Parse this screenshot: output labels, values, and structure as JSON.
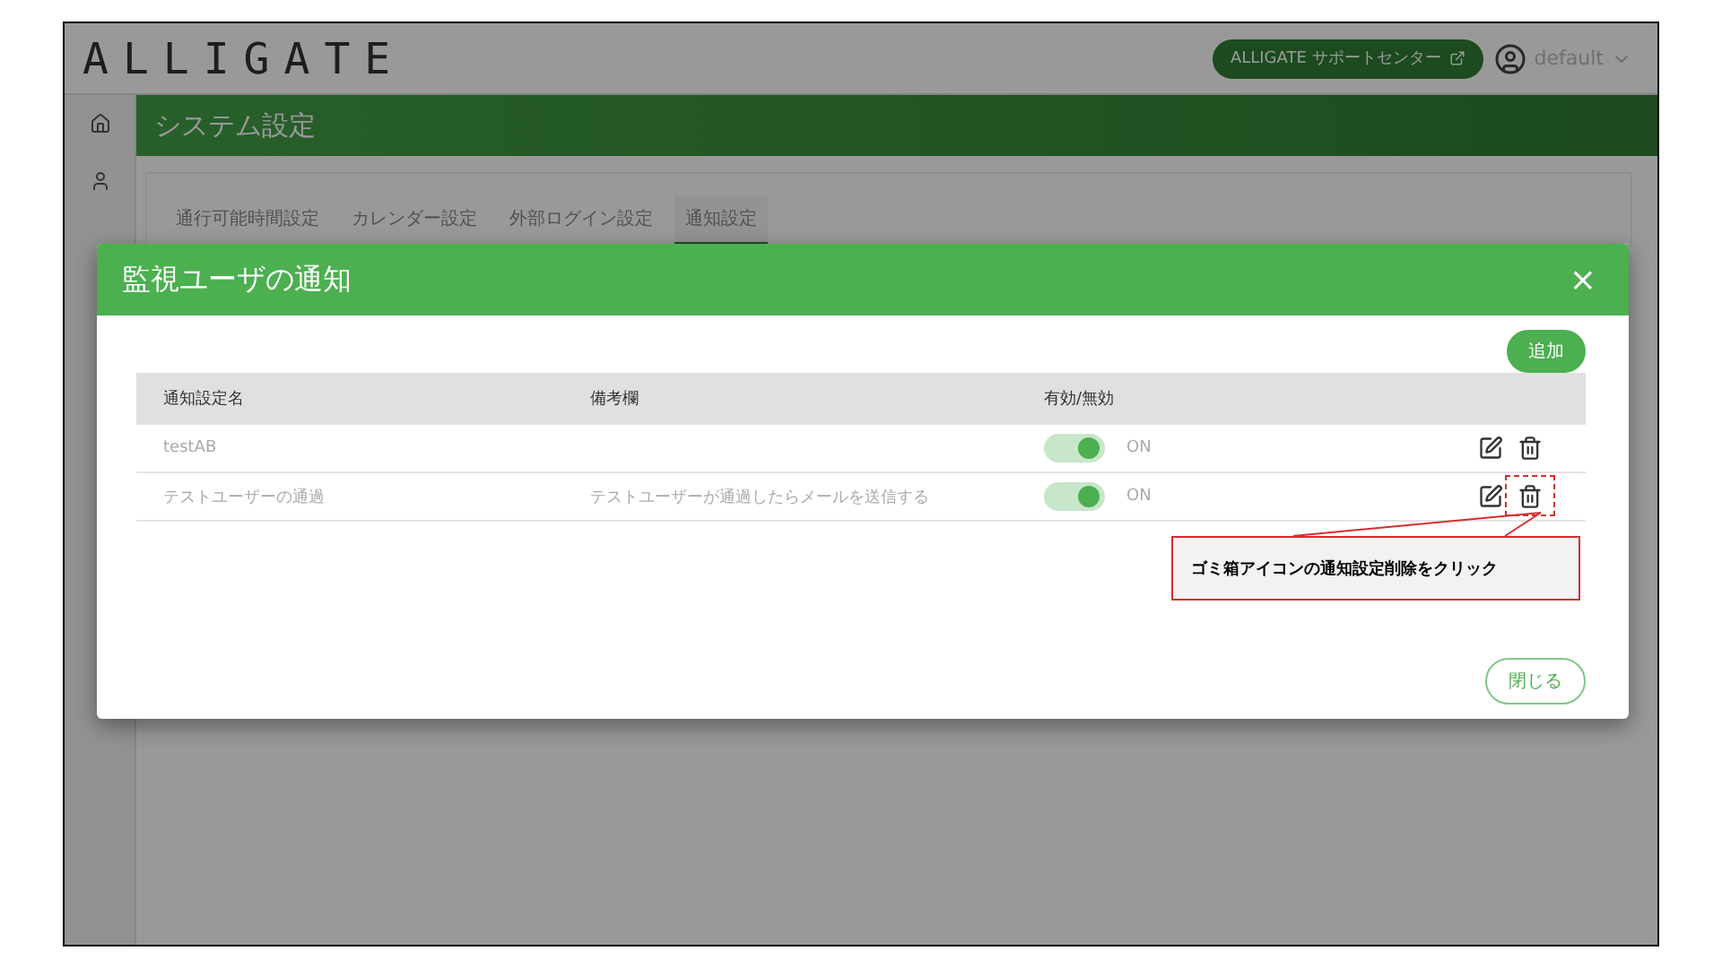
{
  "header": {
    "logo": "ALLIGATE",
    "support_button": "ALLIGATE サポートセンター",
    "user": "default"
  },
  "page_title": "システム設定",
  "tabs": [
    {
      "label": "通行可能時間設定",
      "selected": false
    },
    {
      "label": "カレンダー設定",
      "selected": false
    },
    {
      "label": "外部ログイン設定",
      "selected": false
    },
    {
      "label": "通知設定",
      "selected": true
    }
  ],
  "dialog": {
    "title": "監視ユーザの通知",
    "close": "×",
    "add_button": "追加",
    "columns": [
      "通知設定名",
      "備考欄",
      "有効/無効"
    ],
    "rows": [
      {
        "name": "testAB",
        "enabled": true,
        "status": "ON",
        "highlighted": false
      },
      {
        "name": "テストユーザーの通過",
        "note": "テストユーザーが通過したらメールを送信する",
        "enabled": true,
        "status": "ON",
        "highlighted": true
      }
    ],
    "close_button": "閉じる"
  },
  "annotation": {
    "text": "ゴミ箱アイコンの通知設定削除をクリック"
  }
}
